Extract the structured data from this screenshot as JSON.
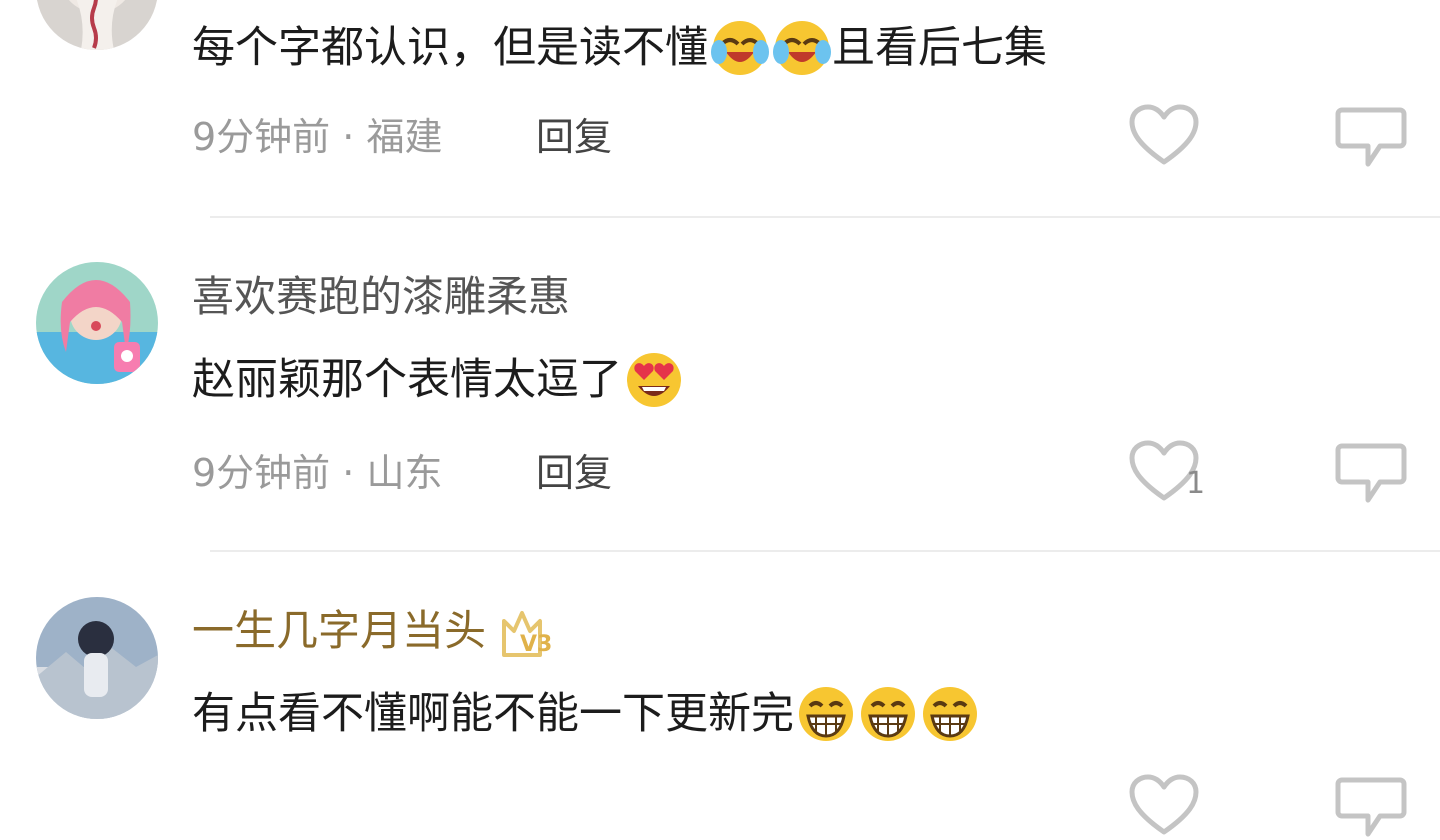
{
  "comments": [
    {
      "username": "",
      "text": "每个字都认识，但是读不懂",
      "emojis_mid": [
        "laugh-cry-emoji",
        "laugh-cry-emoji"
      ],
      "text_after": "且看后七集",
      "time": "9分钟前",
      "location": "福建",
      "reply_label": "回复",
      "likes": ""
    },
    {
      "username": "喜欢赛跑的漆雕柔惠",
      "text": "赵丽颖那个表情太逗了",
      "emojis_end": [
        "heart-eyes-emoji"
      ],
      "time": "9分钟前",
      "location": "山东",
      "reply_label": "回复",
      "likes": "1"
    },
    {
      "username": "一生几字月当头",
      "vip_level": "V3",
      "text": "有点看不懂啊能不能一下更新完",
      "emojis_end": [
        "grin-emoji",
        "grin-emoji",
        "grin-emoji"
      ],
      "time": "",
      "location": "",
      "reply_label": "",
      "likes": ""
    }
  ],
  "separator": "·",
  "colors": {
    "vip_name": "#8a6a2a",
    "meta": "#9a9a9a",
    "icon_stroke": "#c4c4c4"
  }
}
